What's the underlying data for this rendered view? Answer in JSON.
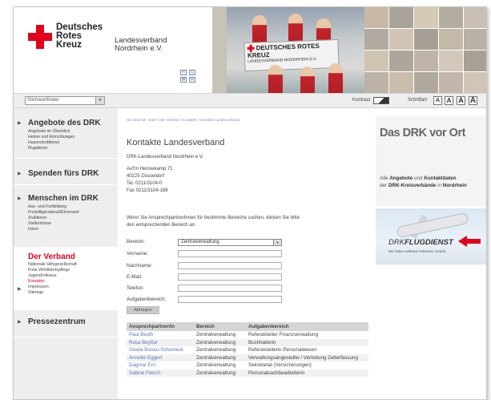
{
  "header": {
    "logo_line1": "Deutsches",
    "logo_line2": "Rotes",
    "logo_line3": "Kreuz",
    "lv_line1": "Landesverband",
    "lv_line2": "Nordrhein e.V.",
    "banner_sign_line1": "DEUTSCHES ROTES KREUZ",
    "banner_sign_line2": "LANDESVERBAND NORDRHEIN E.V."
  },
  "toolbar": {
    "search_value": "Stichwortfinder",
    "kontrast_label": "Kontrast",
    "schrift_label": "Schriftart",
    "size_labels": [
      "A",
      "A",
      "A",
      "A"
    ]
  },
  "nav": [
    {
      "title": "Angebote des DRK",
      "red": false,
      "items": [
        "Angebote im Überblick",
        "Heime und Einrichtungen",
        "Hausnotrufdienst",
        "Flugdienst"
      ]
    },
    {
      "title": "Spenden fürs DRK",
      "red": false,
      "items": []
    },
    {
      "title": "Menschen im DRK",
      "red": false,
      "items": [
        "Aus- und Fortbildung",
        "Freiwilligendienst/Ehrenamt",
        "Zivildienst",
        "Stellenbörse",
        "Intern"
      ]
    },
    {
      "title": "Der Verband",
      "red": true,
      "items": [
        "Nationale Hilfsgesellschaft",
        "Freie Wohlfahrtspflege",
        "Jugendrotkreuz",
        "Kontakte",
        "Impressum",
        "Sitemap"
      ]
    },
    {
      "title": "Pressezentrum",
      "red": false,
      "items": []
    }
  ],
  "content": {
    "breadcrumb": "Sie sind hier: Start / Der Verband / Kontakte / Kontakte Landesverband",
    "heading": "Kontakte Landesverband",
    "org": "DRK-Landesverband Nordrhein e.V.",
    "street": "Auf'm Hennekamp 71",
    "city": "40225 Düsseldorf",
    "tel": "Tel. 0211/3104-0",
    "fax": "Fax 0211/3104-188",
    "intro_line1": "Wenn Sie AnsprechpartnerInnen für bestimmte Bereiche suchen, klicken Sie bitte",
    "intro_line2": "den entsprechenden Bereich an:",
    "form": {
      "bereich_label": "Bereich:",
      "bereich_value": "Zentralverwaltung",
      "vorname_label": "Vorname:",
      "nachname_label": "Nachname:",
      "email_label": "E-Mail:",
      "telefon_label": "Telefon:",
      "aufgaben_label": "Aufgabenbereich:",
      "submit_label": "Abfragen"
    },
    "table": {
      "headers": [
        "Ansprechpartner/in",
        "Bereich",
        "Aufgabenbereich"
      ],
      "rows": [
        {
          "name": "Paul Beuth",
          "bereich": "Zentralverwaltung",
          "aufgabe": "Referatsleiter Finanzverwaltung"
        },
        {
          "name": "Rosa Beyßer",
          "bereich": "Zentralverwaltung",
          "aufgabe": "Buchhalterin"
        },
        {
          "name": "Gisela Bonau-Schomeck",
          "bereich": "Zentralverwaltung",
          "aufgabe": "Referatsleiterin Personalwesen"
        },
        {
          "name": "Annette Eggert",
          "bereich": "Zentralverwaltung",
          "aufgabe": "Verwaltungsangestellte / Vertretung Zetterfassung"
        },
        {
          "name": "Dagmar Ern",
          "bereich": "Zentralverwaltung",
          "aufgabe": "Sekretariat (Versicherungen)"
        },
        {
          "name": "Sabine Fetsch",
          "bereich": "Zentralverwaltung",
          "aufgabe": "Personalsachbearbeiterin"
        }
      ]
    }
  },
  "right": {
    "ort_title": "Das DRK vor Ort",
    "ort_text_pre": "Alle ",
    "ort_text_b1": "Angebote",
    "ort_text_mid": " und ",
    "ort_text_b2": "Kontaktdaten",
    "ort_text_line2_pre": "der ",
    "ort_text_b3": "DRK-Kreisverbände",
    "ort_text_line2_mid": " in ",
    "ort_text_b4": "Nordrhein",
    "flug_logo_a": "DRK",
    "flug_logo_b": "FLUGDIENST",
    "flug_slogan": "Wir holen weltweit Patienten zurück."
  },
  "colors": {
    "brand_red": "#e2001a",
    "link_blue": "#5a7ab8"
  }
}
